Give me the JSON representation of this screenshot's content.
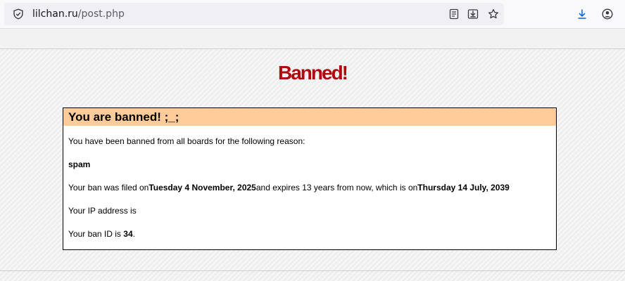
{
  "browser": {
    "url_host": "lilchan.ru",
    "url_path": "/post.php",
    "icons": [
      "shield-icon",
      "reader-view-icon",
      "save-page-icon",
      "bookmark-star-icon",
      "downloads-icon",
      "account-icon"
    ]
  },
  "page": {
    "title": "Banned!",
    "box_header": "You are banned! ;_;",
    "intro": "You have been banned from all boards for the following reason:",
    "reason": "spam",
    "filed_prefix": "Your ban was filed on",
    "filed_date": "Tuesday 4 November, 2025",
    "expires_mid": "and expires 13 years from now, which is on",
    "expires_date": "Thursday 14 July, 2039",
    "ip_text": "Your IP address is",
    "ban_id_prefix": "Your ban ID is ",
    "ban_id": "34",
    "ban_id_suffix": "."
  },
  "colors": {
    "title": "#af0a0f",
    "header_bg": "#ffcc99",
    "downloads_icon": "#0061e0"
  }
}
